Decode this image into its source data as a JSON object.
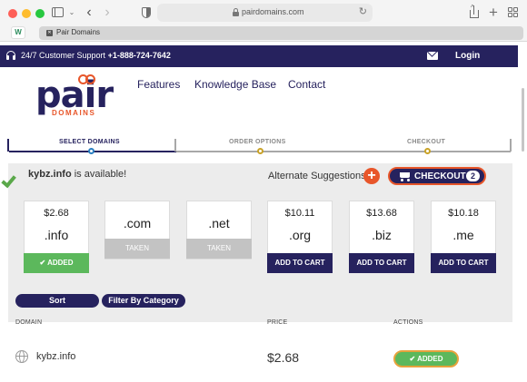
{
  "browser": {
    "url": "pairdomains.com",
    "tab_title": "Pair Domains",
    "extension_label": "W"
  },
  "header": {
    "support_text": "24/7 Customer Support",
    "support_phone": "+1-888-724-7642",
    "login": "Login"
  },
  "logo": {
    "word": "pair",
    "sub": "DOMAINS"
  },
  "nav": {
    "items": [
      "Features",
      "Knowledge Base",
      "Contact"
    ]
  },
  "steps": {
    "items": [
      "SELECT DOMAINS",
      "ORDER OPTIONS",
      "CHECKOUT"
    ],
    "active_color": "#26225e",
    "inactive_color": "#8a8a8a",
    "dot_active": "#2a7fc1",
    "dot_inactive": "#c9a227"
  },
  "availability": {
    "domain": "kybz.info",
    "suffix": " is available!",
    "alternate_label": "Alternate Suggestions",
    "checkout_label": "CHECKOUT",
    "cart_count": "2"
  },
  "cards": [
    {
      "price": "$2.68",
      "tld": ".info",
      "button": "ADDED",
      "state": "added"
    },
    {
      "price": "",
      "tld": ".com",
      "button": "TAKEN",
      "state": "taken"
    },
    {
      "price": "",
      "tld": ".net",
      "button": "TAKEN",
      "state": "taken"
    },
    {
      "price": "$10.11",
      "tld": ".org",
      "button": "ADD TO CART",
      "state": "cart"
    },
    {
      "price": "$13.68",
      "tld": ".biz",
      "button": "ADD TO CART",
      "state": "cart"
    },
    {
      "price": "$10.18",
      "tld": ".me",
      "button": "ADD TO CART",
      "state": "cart"
    }
  ],
  "filters": {
    "sort": "Sort",
    "filter": "Filter By Category"
  },
  "table": {
    "headers": [
      "DOMAIN",
      "PRICE",
      "ACTIONS"
    ],
    "rows": [
      {
        "domain": "kybz.info",
        "price": "$2.68",
        "action": "ADDED"
      }
    ]
  },
  "colors": {
    "brand_navy": "#26225e",
    "brand_orange": "#e8562a",
    "added_green": "#5cb85c"
  }
}
